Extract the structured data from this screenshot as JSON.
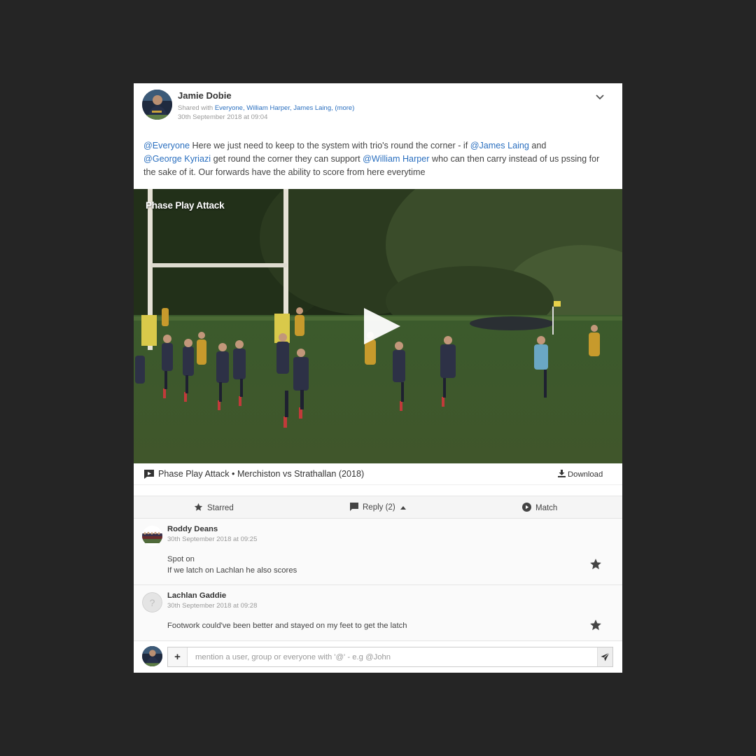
{
  "post": {
    "author": "Jamie Dobie",
    "shared_prefix": "Shared with ",
    "shared_links": "Everyone, William Harper, James Laing, (more)",
    "date": "30th September 2018 at 09:04",
    "body": {
      "m1": "@Everyone",
      "t1": " Here we just need to keep to the system with trio's round the corner - if ",
      "m2": "@James Laing",
      "t2": " and ",
      "m3": "@George Kyriazi",
      "t3": " get round the corner they can support ",
      "m4": "@William Harper",
      "t4": " who can then carry instead of us pssing for the sake of it. Our forwards have the ability to score from here everytime"
    }
  },
  "video": {
    "title": "Phase Play Attack",
    "colors": {
      "grass": "#3f5a2a",
      "trees": "#27341d",
      "posts": "#e6e2d6",
      "pads": "#d9c94a",
      "team_a": "#2d3146",
      "team_b": "#c79a2c"
    }
  },
  "clip": {
    "name": "Phase Play Attack",
    "separator": " • ",
    "match": "Merchiston vs Strathallan (2018)",
    "download": "Download"
  },
  "actions": {
    "starred": "Starred",
    "reply": "Reply (2)",
    "match": "Match"
  },
  "comments": [
    {
      "author": "Roddy Deans",
      "date": "30th September 2018 at 09:25",
      "line1": "Spot on",
      "line2": "If we latch on Lachlan he also scores"
    },
    {
      "author": "Lachlan Gaddie",
      "date": "30th September 2018 at 09:28",
      "line1": "Footwork could've been better and stayed on my feet to get the latch"
    }
  ],
  "reply_input": {
    "placeholder": "mention a user, group or everyone with '@' - e.g @John"
  },
  "colors": {
    "link": "#2a6fbf",
    "page_bg": "#252525",
    "star": "#444444"
  },
  "icons": {
    "expand": "chevron-down-icon",
    "clip": "comment-video-icon",
    "download": "download-icon",
    "starred": "star-icon",
    "reply": "reply-icon",
    "match": "play-circle-icon",
    "add": "plus-icon",
    "send": "send-icon"
  }
}
